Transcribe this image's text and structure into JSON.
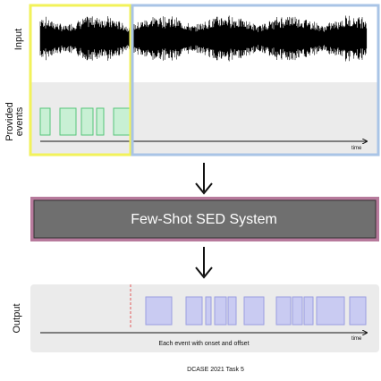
{
  "labels": {
    "input": "Input",
    "provided_line1": "Provided",
    "provided_line2": "events",
    "output": "Output",
    "time_top": "time",
    "time_bottom": "time",
    "system": "Few-Shot SED System",
    "caption": "Each event with onset and offset",
    "footer": "DCASE 2021 Task 5"
  },
  "colors": {
    "support_highlight": "#f2f25a",
    "query_highlight": "#a9c4e6",
    "provided_event_fill": "#c8f0d4",
    "provided_event_stroke": "#55c47a",
    "output_event_fill": "#c9cbf2",
    "output_event_stroke": "#9a9ee0",
    "system_fill": "#6f6f6f",
    "system_border": "#b77a9c",
    "panel_fill": "#ebebeb",
    "onset_line": "#e05a5a"
  },
  "icons": [
    "down-arrow-icon",
    "time-axis-arrow-icon"
  ]
}
